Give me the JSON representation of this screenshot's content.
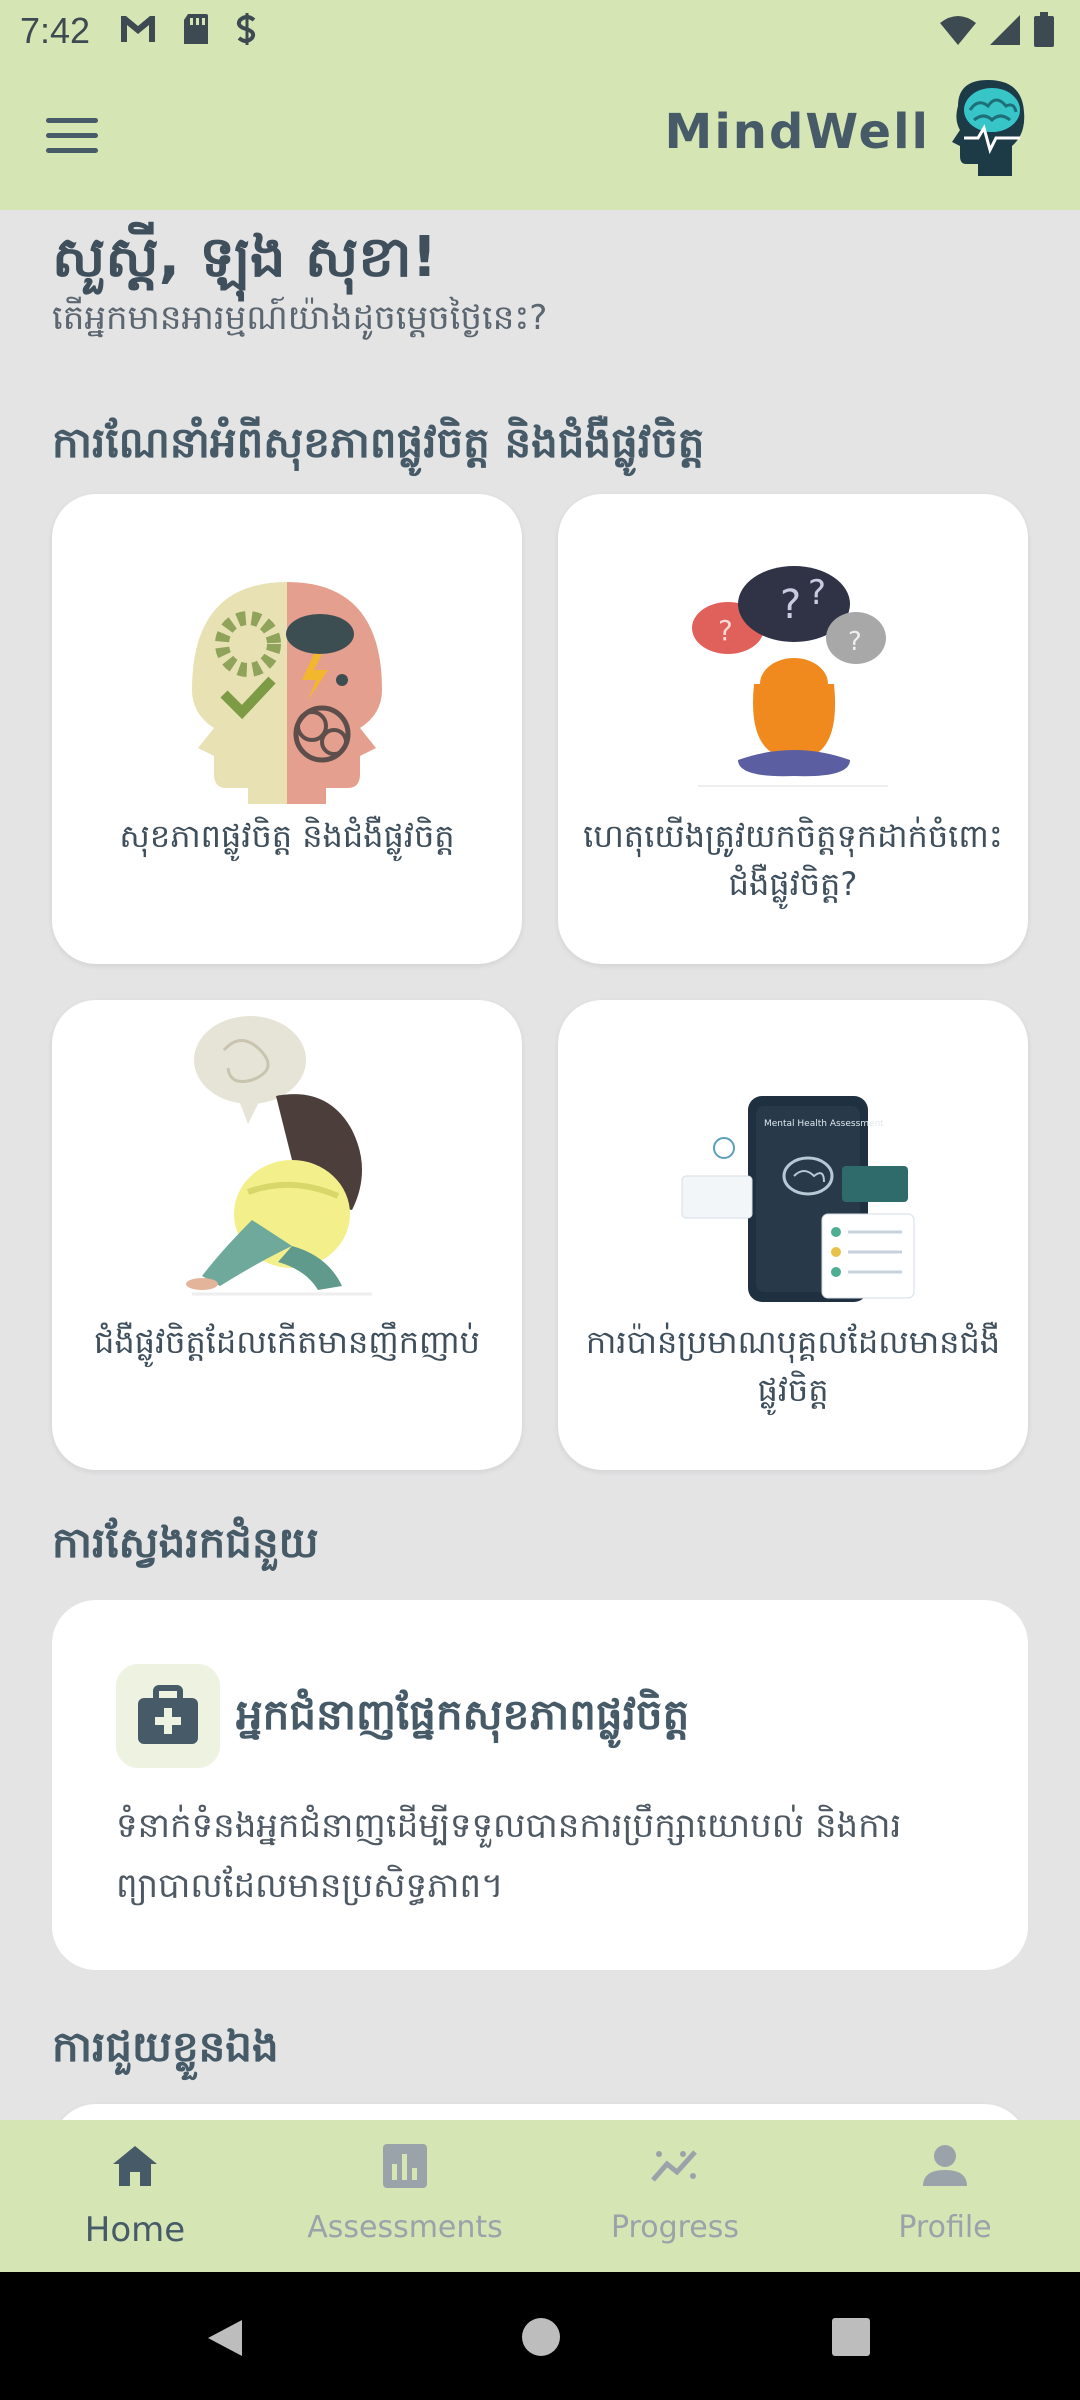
{
  "status": {
    "time": "7:42"
  },
  "app": {
    "title": "MindWell"
  },
  "greeting": {
    "title": "សួស្តី, ឡុង សុខា!",
    "subtitle": "តើអ្នកមានអារម្មណ៍យ៉ាងដូចម្តេចថ្ងៃនេះ?"
  },
  "sections": {
    "guide": "ការណែនាំអំពីសុខភាពផ្លូវចិត្ត និងជំងឺផ្លូវចិត្ត",
    "help": "ការស្វែងរកជំនួយ",
    "self": "ការជួយខ្លួនឯង"
  },
  "cards": [
    {
      "label": "សុខភាពផ្លូវចិត្ត និងជំងឺផ្លូវចិត្ត"
    },
    {
      "label": "ហេតុយើងត្រូវយកចិត្តទុកដាក់ចំពោះជំងឺផ្លូវចិត្ត?"
    },
    {
      "label": "ជំងឺផ្លូវចិត្តដែលកើតមានញឹកញាប់"
    },
    {
      "label": "ការប៉ាន់ប្រមាណបុគ្គលដែលមានជំងឺផ្លូវចិត្ត"
    }
  ],
  "help_card": {
    "title": "អ្នកជំនាញផ្នែកសុខភាពផ្លូវចិត្ត",
    "description": "ទំនាក់ទំនងអ្នកជំនាញដើម្បីទទួលបានការប្រឹក្សាយោបល់ និងការព្យាបាលដែលមានប្រសិទ្ធភាព។"
  },
  "illustration_texts": {
    "phone_screen": "Mental Health Assessment",
    "question_marks": "?"
  },
  "nav": [
    {
      "label": "Home",
      "icon": "home-icon",
      "active": true
    },
    {
      "label": "Assessments",
      "icon": "bar-chart-icon",
      "active": false
    },
    {
      "label": "Progress",
      "icon": "progress-chart-icon",
      "active": false
    },
    {
      "label": "Profile",
      "icon": "person-icon",
      "active": false
    }
  ],
  "colors": {
    "app_bar": "#d6e5b4",
    "background": "#e4e4e5",
    "primary_text": "#465a68",
    "inactive_nav": "#9aa3aa"
  }
}
